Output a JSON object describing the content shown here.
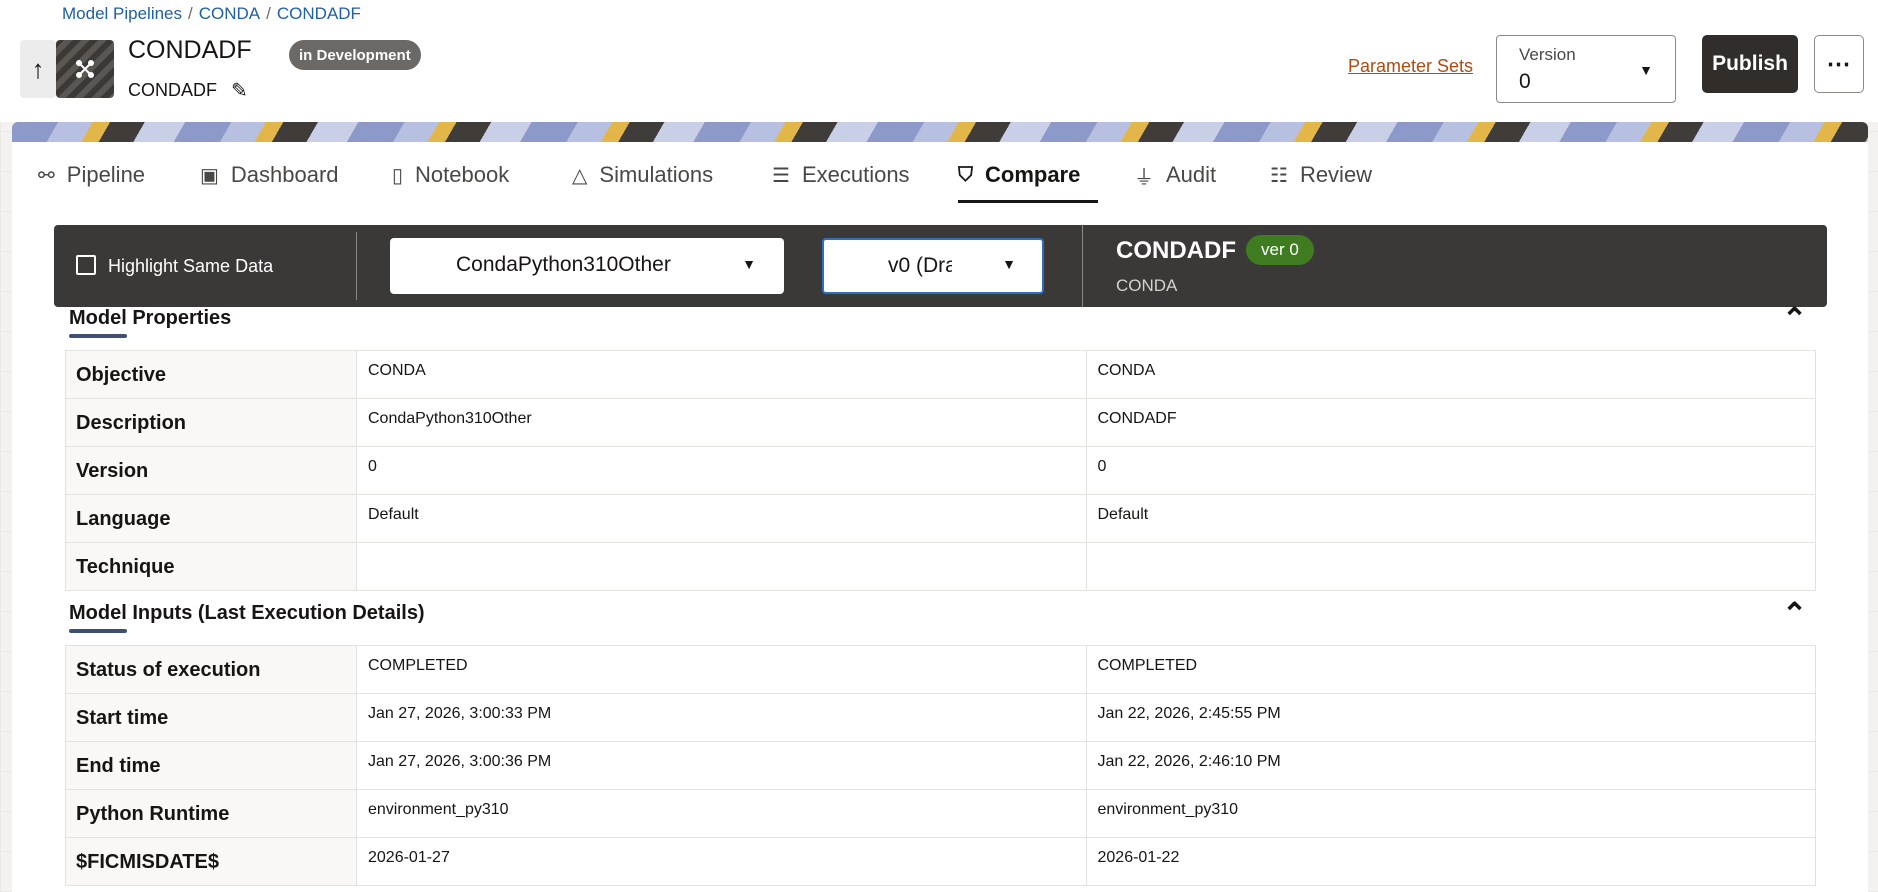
{
  "breadcrumb": [
    "Model Pipelines",
    "CONDA",
    "CONDADF"
  ],
  "header": {
    "title": "CONDADF",
    "subtitle": "CONDADF",
    "status": "in Development",
    "parameter_sets": "Parameter Sets",
    "version_label": "Version",
    "version_value": "0",
    "publish": "Publish",
    "more": "⋯"
  },
  "tabs": [
    {
      "label": "Pipeline",
      "icon": "pipeline-icon"
    },
    {
      "label": "Dashboard",
      "icon": "dashboard-icon"
    },
    {
      "label": "Notebook",
      "icon": "notebook-icon"
    },
    {
      "label": "Simulations",
      "icon": "simulations-icon"
    },
    {
      "label": "Executions",
      "icon": "executions-icon"
    },
    {
      "label": "Compare",
      "icon": "map-icon",
      "active": true
    },
    {
      "label": "Audit",
      "icon": "funnel-icon"
    },
    {
      "label": "Review",
      "icon": "review-icon"
    }
  ],
  "toolbar": {
    "highlight_label": "Highlight Same Data",
    "model_select": "CondaPython310Other",
    "version_select": "v0 (Dra",
    "compare_title": "CONDADF",
    "compare_badge": "ver 0",
    "compare_sub": "CONDA"
  },
  "sections": [
    {
      "title": "Model Properties",
      "rows": [
        {
          "key": "Objective",
          "left": "CONDA",
          "right": "CONDA"
        },
        {
          "key": "Description",
          "left": "CondaPython310Other",
          "right": "CONDADF"
        },
        {
          "key": "Version",
          "left": "0",
          "right": "0"
        },
        {
          "key": "Language",
          "left": "Default",
          "right": "Default"
        },
        {
          "key": "Technique",
          "left": "",
          "right": ""
        }
      ]
    },
    {
      "title": "Model Inputs (Last Execution Details)",
      "rows": [
        {
          "key": "Status of execution",
          "left": "COMPLETED",
          "right": "COMPLETED"
        },
        {
          "key": "Start time",
          "left": "Jan 27, 2026, 3:00:33 PM",
          "right": "Jan 22, 2026, 2:45:55 PM"
        },
        {
          "key": "End time",
          "left": "Jan 27, 2026, 3:00:36 PM",
          "right": "Jan 22, 2026, 2:46:10 PM"
        },
        {
          "key": "Python Runtime",
          "left": "environment_py310",
          "right": "environment_py310"
        },
        {
          "key": "$FICMISDATE$",
          "left": "2026-01-27",
          "right": "2026-01-22"
        }
      ]
    }
  ],
  "colors": {
    "accent_dark": "#3b3937",
    "badge_green": "#3e7c1f",
    "link_orange": "#b4490e",
    "breadcrumb_blue": "#1e5fa8"
  }
}
